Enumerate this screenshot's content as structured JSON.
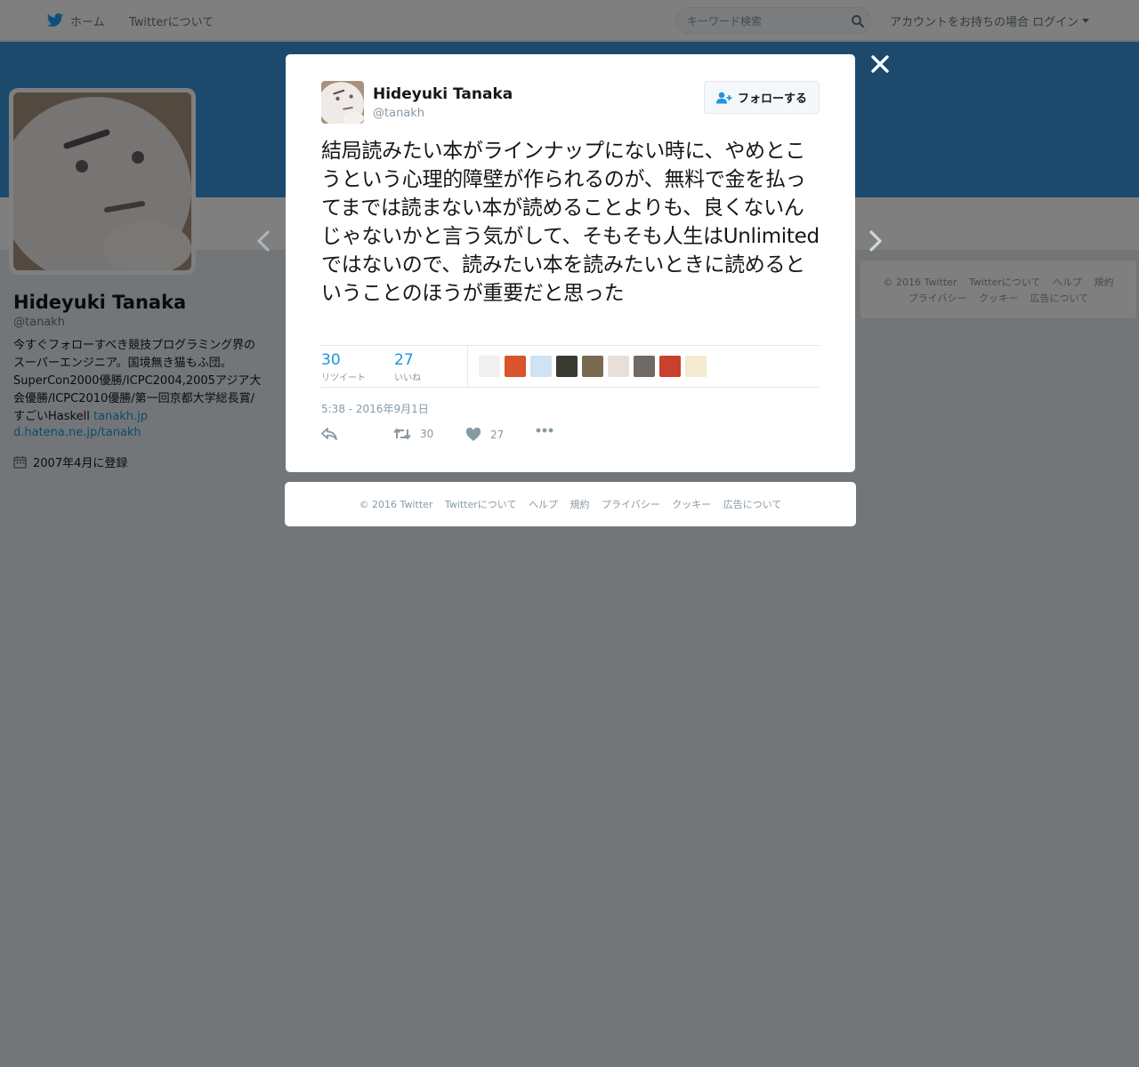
{
  "topbar": {
    "home_label": "ホーム",
    "about_label": "Twitterについて",
    "search_placeholder": "キーワード検索",
    "login_label": "アカウントをお持ちの場合 ログイン"
  },
  "profile": {
    "name": "Hideyuki Tanaka",
    "handle": "@tanakh",
    "bio": "今すぐフォローすべき競技プログラミング界のスーパーエンジニア。国境無き猫もふ団。SuperCon2000優勝/ICPC2004,2005アジア大会優勝/ICPC2010優勝/第一回京都大学総長賞/すごいHaskell ",
    "bio_link": "tanakh.jp",
    "url": "d.hatena.ne.jp/tanakh",
    "joined": "2007年4月に登録"
  },
  "side_footer": {
    "row1": [
      "© 2016 Twitter",
      "Twitterについて",
      "ヘルプ",
      "規約"
    ],
    "row2": [
      "プライバシー",
      "クッキー",
      "広告について"
    ]
  },
  "tweet": {
    "author_name": "Hideyuki Tanaka",
    "author_handle": "@tanakh",
    "follow_label": "フォローする",
    "text": "結局読みたい本がラインナップにない時に、やめとこうという心理的障壁が作られるのが、無料で金を払ってまでは読まない本が読めることよりも、良くないんじゃないかと言う気がして、そもそも人生はUnlimitedではないので、読みたい本を読みたいときに読めるということのほうが重要だと思った",
    "retweets": "30",
    "retweets_label": "リツイート",
    "likes": "27",
    "likes_label": "いいね",
    "timestamp": "5:38 - 2016年9月1日",
    "action_retweet_count": "30",
    "action_like_count": "27"
  },
  "modal_footer": [
    "© 2016 Twitter",
    "Twitterについて",
    "ヘルプ",
    "規約",
    "プライバシー",
    "クッキー",
    "広告について"
  ],
  "likers": [
    {
      "icon": "cat-avatar-icon",
      "color": "#f0f0f0"
    },
    {
      "icon": "orange-avatar-icon",
      "color": "#d9532b"
    },
    {
      "icon": "blue-sketch-avatar-icon",
      "color": "#cfe3f2"
    },
    {
      "icon": "yellow-character-avatar-icon",
      "color": "#3a3a30"
    },
    {
      "icon": "bear-avatar-icon",
      "color": "#7a6a4f"
    },
    {
      "icon": "anime-girl-avatar-icon",
      "color": "#e8e0d8"
    },
    {
      "icon": "cat-photo-avatar-icon",
      "color": "#6f6a66"
    },
    {
      "icon": "red-character-avatar-icon",
      "color": "#c9402d"
    },
    {
      "icon": "blonde-character-avatar-icon",
      "color": "#f4ead0"
    }
  ],
  "colors": {
    "accent": "#1b95e0",
    "banner": "#3b94d9",
    "overlay": "rgba(0,0,0,0.5)"
  }
}
